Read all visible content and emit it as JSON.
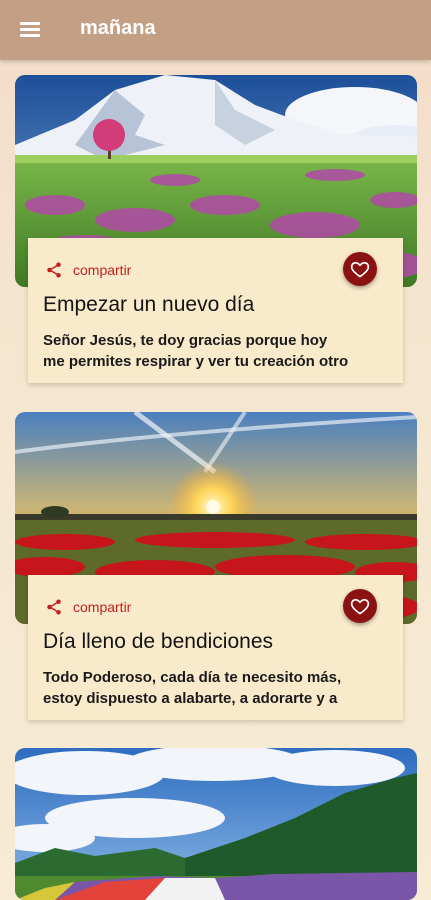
{
  "appbar": {
    "title": "mañana",
    "menu_icon": "hamburger-menu-icon"
  },
  "cards": [
    {
      "share_label": "compartir",
      "title": "Empezar un nuevo día",
      "text_line1": "Señor Jesús, te doy gracias porque hoy",
      "text_line2": "me permites respirar y ver tu creación otro"
    },
    {
      "share_label": "compartir",
      "title": "Día lleno de bendiciones",
      "text_line1": "Todo Poderoso, cada día te necesito más,",
      "text_line2": "estoy dispuesto a alabarte, a adorarte y a"
    }
  ],
  "colors": {
    "appbar": "#c39f85",
    "accent_red": "#c21f1f",
    "heart_button": "#8b1212",
    "card_bg": "#f9eacb"
  }
}
